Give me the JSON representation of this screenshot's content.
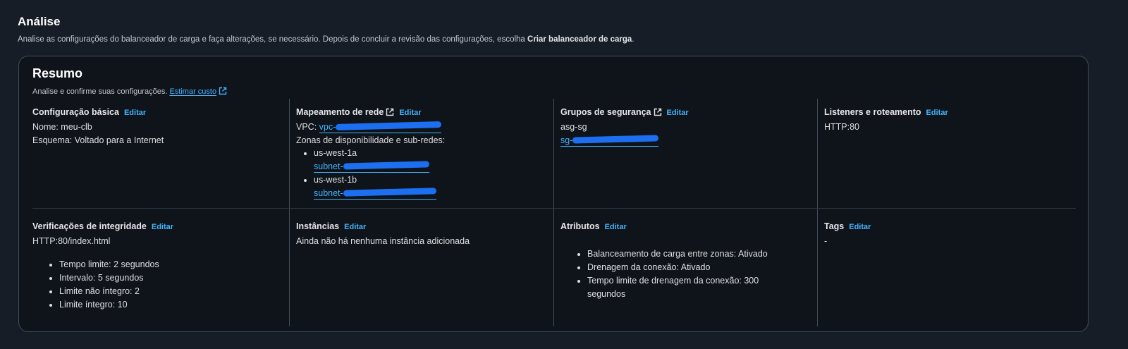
{
  "header": {
    "title": "Análise",
    "description_prefix": "Analise as configurações do balanceador de carga e faça alterações, se necessário. Depois de concluir a revisão das configurações, escolha ",
    "description_bold": "Criar balanceador de carga",
    "description_suffix": "."
  },
  "summary": {
    "title": "Resumo",
    "description": "Analise e confirme suas configurações.",
    "estimate_link": "Estimar custo"
  },
  "basic_config": {
    "title": "Configuração básica",
    "edit": "Editar",
    "name": "Nome: meu-clb",
    "scheme": "Esquema: Voltado para a Internet"
  },
  "network_mapping": {
    "title": "Mapeamento de rede",
    "edit": "Editar",
    "vpc_label": "VPC:",
    "vpc_value_prefix": "vpc-",
    "zones_label": "Zonas de disponibilidade e sub-redes:",
    "zones": [
      {
        "name": "us-west-1a",
        "subnet_prefix": "subnet-"
      },
      {
        "name": "us-west-1b",
        "subnet_prefix": "subnet-"
      }
    ]
  },
  "security_groups": {
    "title": "Grupos de segurança",
    "edit": "Editar",
    "group_name": "asg-sg",
    "group_id_prefix": "sg-"
  },
  "listeners": {
    "title": "Listeners e roteamento",
    "edit": "Editar",
    "value": "HTTP:80"
  },
  "health_checks": {
    "title": "Verificações de integridade",
    "edit": "Editar",
    "target": "HTTP:80/index.html",
    "items": [
      "Tempo limite: 2 segundos",
      "Intervalo: 5 segundos",
      "Limite não íntegro: 2",
      "Limite íntegro: 10"
    ]
  },
  "instances": {
    "title": "Instâncias",
    "edit": "Editar",
    "value": "Ainda não há nenhuma instância adicionada"
  },
  "attributes": {
    "title": "Atributos",
    "edit": "Editar",
    "items": [
      "Balanceamento de carga entre zonas: Ativado",
      "Drenagem da conexão: Ativado",
      "Tempo limite de drenagem da conexão: 300",
      "segundos"
    ]
  },
  "tags": {
    "title": "Tags",
    "edit": "Editar",
    "value": "-"
  },
  "colors": {
    "background": "#161d26",
    "panel": "#0f141a",
    "border": "#414d5c",
    "link": "#42b4ff",
    "redaction": "#1d6ff2"
  }
}
